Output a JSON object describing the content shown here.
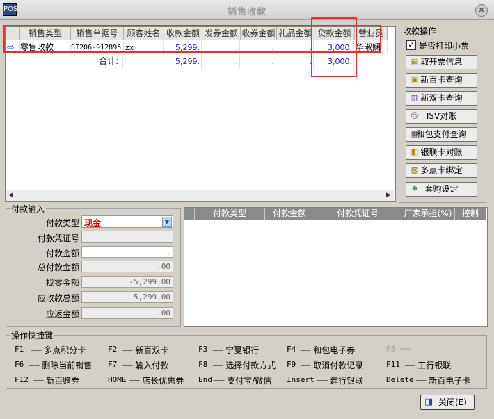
{
  "window": {
    "title": "销售收款",
    "app_icon": "POS"
  },
  "sales_grid": {
    "headers": [
      "",
      "销售类型",
      "销售单据号",
      "顾客姓名",
      "收款金额",
      "发券金额",
      "收券金额",
      "礼品金额",
      "贷款金额",
      "营业员"
    ],
    "row": {
      "type": "零售收款",
      "doc_no": "SI206-912895",
      "customer": "zx",
      "receive_amount": "5,299.",
      "coupon_issue": ".",
      "coupon_receive": ".",
      "gift_amount": ".",
      "loan_amount": "3,000.",
      "clerk": "华淑娴"
    },
    "total": {
      "label": "合计:",
      "receive_amount": "5,299.",
      "coupon_issue": ".",
      "coupon_receive": ".",
      "gift_amount": ".",
      "loan_amount": "3,000."
    }
  },
  "ops": {
    "label": "收款操作",
    "print_receipt": {
      "label": "是否打印小票",
      "checked": "✓"
    },
    "buttons": [
      {
        "name": "cancel-invoice-button",
        "label": "取开票信息",
        "icon": "ticket-icon",
        "glyph": "▤"
      },
      {
        "name": "xinbai-card-query-button",
        "label": "新百卡查询",
        "icon": "card-icon",
        "glyph": "▣"
      },
      {
        "name": "xinshuang-card-query-button",
        "label": "新双卡查询",
        "icon": "card-icon",
        "glyph": "▥"
      },
      {
        "name": "isv-reconcile-button",
        "label": "ISV对账",
        "icon": "user-icon",
        "glyph": "☺"
      },
      {
        "name": "hebao-pay-query-button",
        "label": "和包支付查询",
        "icon": "grid-icon",
        "glyph": "▦"
      },
      {
        "name": "unionpay-reconcile-button",
        "label": "银联卡对账",
        "icon": "card-reader-icon",
        "glyph": "◧"
      },
      {
        "name": "multipoint-card-bind-button",
        "label": "多点卡绑定",
        "icon": "form-icon",
        "glyph": "▧"
      },
      {
        "name": "bundle-setting-button",
        "label": "套购设定",
        "icon": "gift-icon",
        "glyph": "❖"
      }
    ]
  },
  "payment_input": {
    "label": "付款输入",
    "type_label": "付款类型",
    "type_value": "现金",
    "voucher_label": "付款凭证号",
    "voucher_value": "",
    "amount_label": "付款金额",
    "amount_value": ".",
    "total_paid_label": "总付款金额",
    "total_paid_value": ".00",
    "change_label": "找零金额",
    "change_value": "-5,299.00",
    "total_receivable_label": "应收款总额",
    "total_receivable_value": "5,299.00",
    "refund_label": "应返金额",
    "refund_value": ".00"
  },
  "payment_grid": {
    "headers": [
      "付款类型",
      "付款金额",
      "付款凭证号",
      "厂家承担(%)",
      "控制"
    ]
  },
  "shortcuts": {
    "label": "操作快捷键",
    "items": [
      {
        "key": "F1",
        "label": "多点积分卡"
      },
      {
        "key": "F2",
        "label": "新百双卡"
      },
      {
        "key": "F3",
        "label": "宁夏银行"
      },
      {
        "key": "F4",
        "label": "和包电子券"
      },
      {
        "key": "F5",
        "label": ""
      },
      {
        "key": "F6",
        "label": "删除当前销售"
      },
      {
        "key": "F7",
        "label": "输入付款"
      },
      {
        "key": "F8",
        "label": "选择付款方式"
      },
      {
        "key": "F9",
        "label": "取消付款记录"
      },
      {
        "key": "F11",
        "label": "工行银联"
      },
      {
        "key": "F12",
        "label": "新百赠券"
      },
      {
        "key": "HOME",
        "label": "店长优惠券"
      },
      {
        "key": "End",
        "label": "支付宝/微信"
      },
      {
        "key": "Insert",
        "label": "建行银联"
      },
      {
        "key": "Delete",
        "label": "新百电子卡"
      }
    ]
  },
  "close_button": {
    "label": "关闭(E)"
  },
  "colors": {
    "highlight": "#e53030",
    "amount": "#1a1acc",
    "cash": "#cc0000"
  }
}
